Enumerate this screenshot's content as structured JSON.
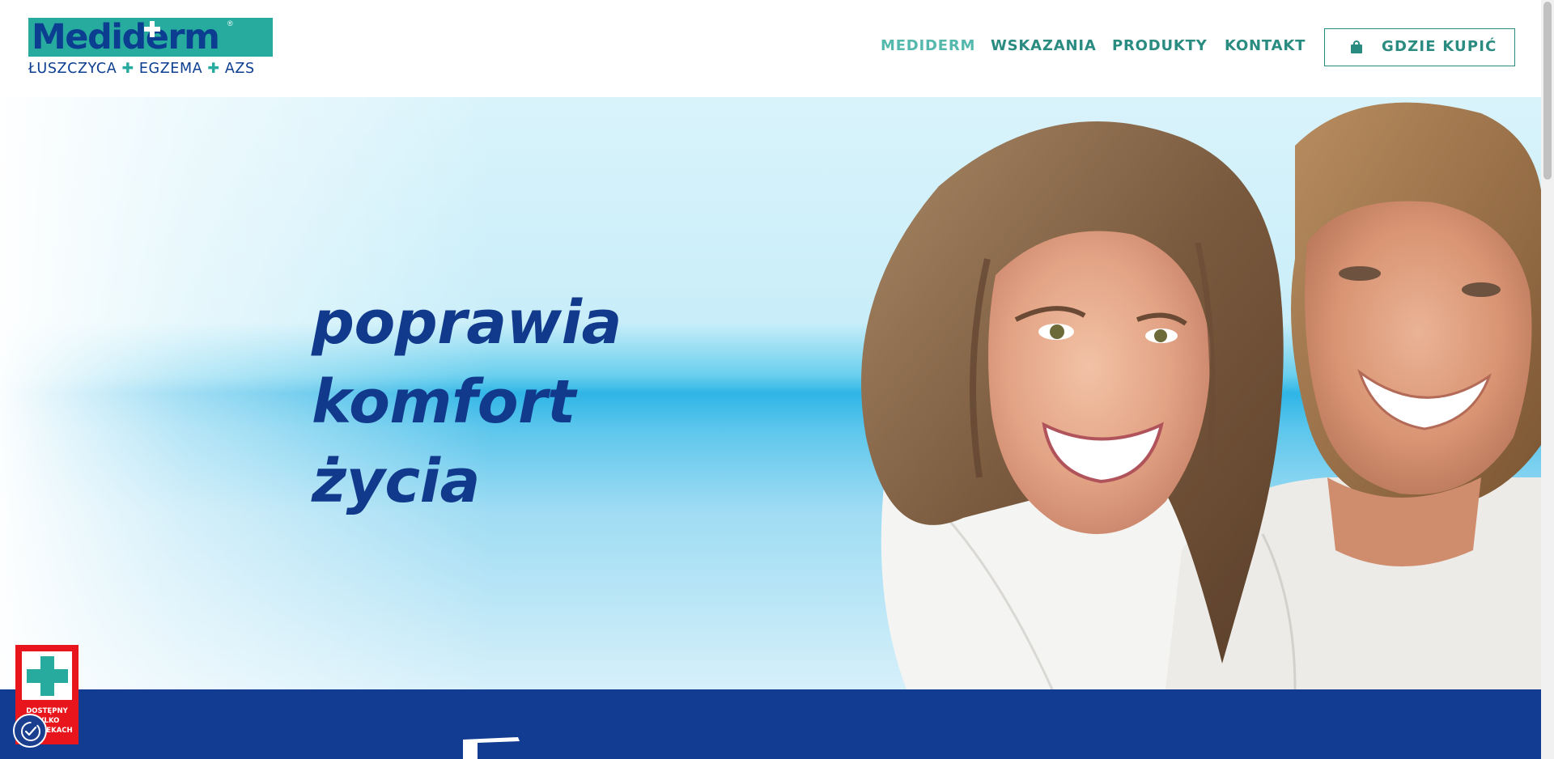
{
  "brand": {
    "logo_word": "Mediderm",
    "logo_reg": "®",
    "tagline_parts": [
      "ŁUSZCZYCA",
      "✚",
      "EGZEMA",
      "✚",
      "AZS"
    ]
  },
  "nav": {
    "items": [
      {
        "label": "MEDIDERM",
        "active": true
      },
      {
        "label": "WSKAZANIA",
        "active": false
      },
      {
        "label": "PRODUKTY",
        "active": false
      },
      {
        "label": "KONTAKT",
        "active": false
      }
    ],
    "buy_button": {
      "label": "GDZIE KUPIĆ",
      "icon": "shopping-bag-icon"
    }
  },
  "hero": {
    "headline": [
      "poprawia",
      "komfort",
      "życia"
    ]
  },
  "pharmacy_badge": {
    "lines": [
      "DOSTĘPNY",
      "TYLKO",
      "W APTEKACH"
    ],
    "icon": "pharmacy-cross-icon"
  },
  "accessibility_button": {
    "icon": "accessibility-icon"
  },
  "colors": {
    "teal": "#27ab9f",
    "nav_teal": "#2a8b80",
    "navy": "#123a8c",
    "band_blue": "#123c91",
    "badge_red": "#e8161c"
  }
}
